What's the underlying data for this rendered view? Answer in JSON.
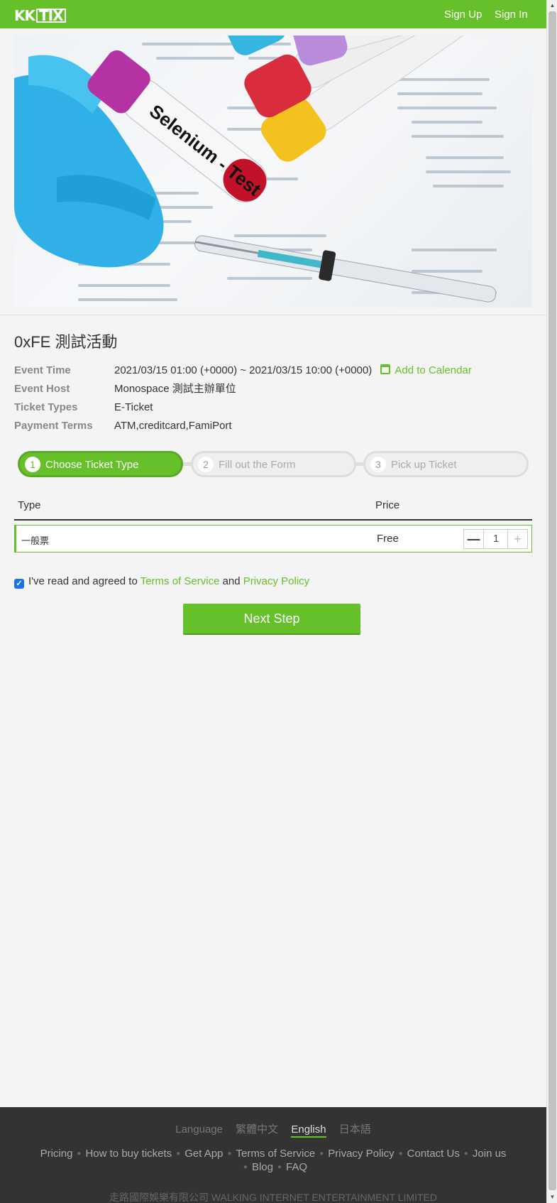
{
  "header": {
    "logo": "KKTIX",
    "sign_up": "Sign Up",
    "sign_in": "Sign In",
    "brand_color": "#66c02a"
  },
  "banner": {
    "tube_label": "Selenium - Test"
  },
  "event": {
    "title": "0xFE 測試活動",
    "rows": [
      {
        "label": "Event Time",
        "value": "2021/03/15 01:00 (+0000) ~ 2021/03/15 10:00 (+0000)"
      },
      {
        "label": "Event Host",
        "value": "Monospace 測試主辦單位"
      },
      {
        "label": "Ticket Types",
        "value": "E-Ticket"
      },
      {
        "label": "Payment Terms",
        "value": "ATM,creditcard,FamiPort"
      }
    ],
    "add_to_calendar": "Add to Calendar",
    "calendar_icon": "calendar-icon"
  },
  "steps": [
    {
      "num": "1",
      "label": "Choose Ticket Type"
    },
    {
      "num": "2",
      "label": "Fill out the Form"
    },
    {
      "num": "3",
      "label": "Pick up Ticket"
    }
  ],
  "ticket_table": {
    "col_type": "Type",
    "col_price": "Price",
    "rows": [
      {
        "name": "一般票",
        "price": "Free",
        "qty": "1"
      }
    ]
  },
  "agreement": {
    "prefix": "I've read and agreed to",
    "tos": "Terms of Service",
    "and": "and",
    "privacy": "Privacy Policy",
    "checked": true
  },
  "next_button": "Next Step",
  "footer": {
    "language_label": "Language",
    "languages": [
      "繁體中文",
      "English",
      "日本語"
    ],
    "links": [
      "Pricing",
      "How to buy tickets",
      "Get App",
      "Terms of Service",
      "Privacy Policy",
      "Contact Us",
      "Join us",
      "Blog",
      "FAQ"
    ],
    "copyright": "走路國際娛樂有限公司 WALKING INTERNET ENTERTAINMENT LIMITED"
  }
}
